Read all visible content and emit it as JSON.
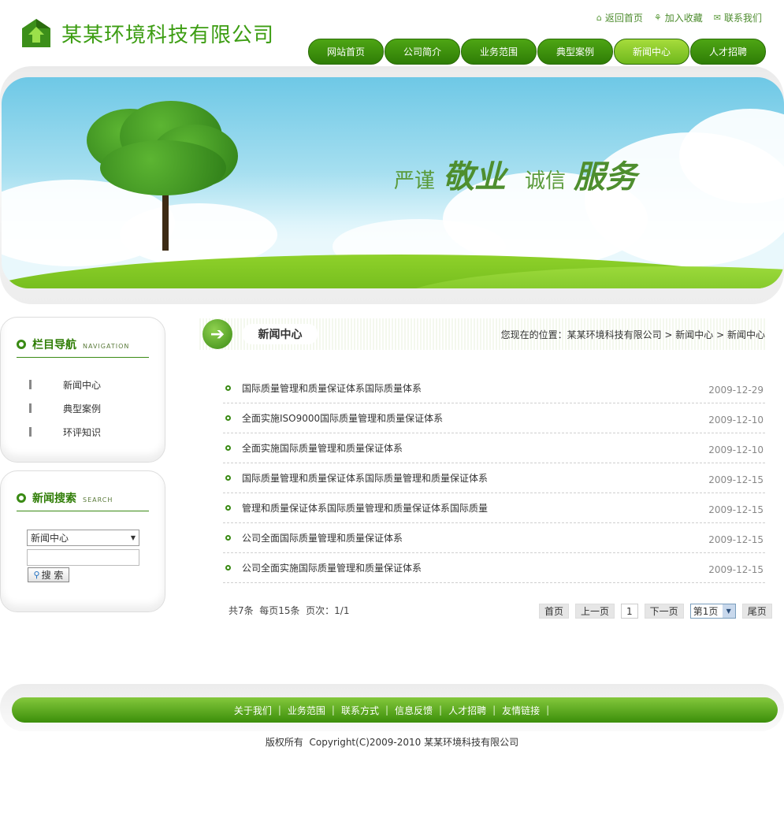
{
  "company": {
    "name": "某某环境科技有限公司"
  },
  "top_links": [
    {
      "icon": "home-icon",
      "label": "返回首页"
    },
    {
      "icon": "bookmark-icon",
      "label": "加入收藏"
    },
    {
      "icon": "mail-icon",
      "label": "联系我们"
    }
  ],
  "nav": {
    "items": [
      "网站首页",
      "公司简介",
      "业务范围",
      "典型案例",
      "新闻中心",
      "人才招聘"
    ],
    "active": "新闻中心"
  },
  "banner": {
    "slogan": [
      "严谨",
      "敬业",
      "诚信",
      "服务"
    ]
  },
  "sidebar_nav": {
    "title": "栏目导航",
    "subtitle": "NAVIGATION",
    "items": [
      "新闻中心",
      "典型案例",
      "环评知识"
    ]
  },
  "sidebar_search": {
    "title": "新闻搜索",
    "subtitle": "SEARCH",
    "category": "新闻中心",
    "keyword_value": "",
    "button_label": "搜 索"
  },
  "main": {
    "heading": "新闻中心",
    "breadcrumb": {
      "prefix": "您现在的位置：",
      "items": [
        "某某环境科技有限公司",
        "新闻中心",
        "新闻中心"
      ],
      "separator": " > "
    }
  },
  "news": [
    {
      "title": "国际质量管理和质量保证体系国际质量体系",
      "date": "2009-12-29"
    },
    {
      "title": "全面实施ISO9000国际质量管理和质量保证体系",
      "date": "2009-12-10"
    },
    {
      "title": "全面实施国际质量管理和质量保证体系",
      "date": "2009-12-10"
    },
    {
      "title": "国际质量管理和质量保证体系国际质量管理和质量保证体系",
      "date": "2009-12-15"
    },
    {
      "title": "管理和质量保证体系国际质量管理和质量保证体系国际质量",
      "date": "2009-12-15"
    },
    {
      "title": "公司全面国际质量管理和质量保证体系",
      "date": "2009-12-15"
    },
    {
      "title": "公司全面实施国际质量管理和质量保证体系",
      "date": "2009-12-15"
    }
  ],
  "pager": {
    "info": "共7条  每页15条  页次：1/1",
    "first": "首页",
    "prev": "上一页",
    "current": "1",
    "next": "下一页",
    "select_value": "第1页",
    "last": "尾页"
  },
  "footer": {
    "links": [
      "关于我们",
      "业务范围",
      "联系方式",
      "信息反馈",
      "人才招聘",
      "友情链接"
    ],
    "copyright": "版权所有  Copyright(C)2009-2010 某某环境科技有限公司"
  },
  "colors": {
    "brand_green": "#3c9d12",
    "dark_green": "#2f7d06",
    "active_nav": "#8ccb2c"
  }
}
